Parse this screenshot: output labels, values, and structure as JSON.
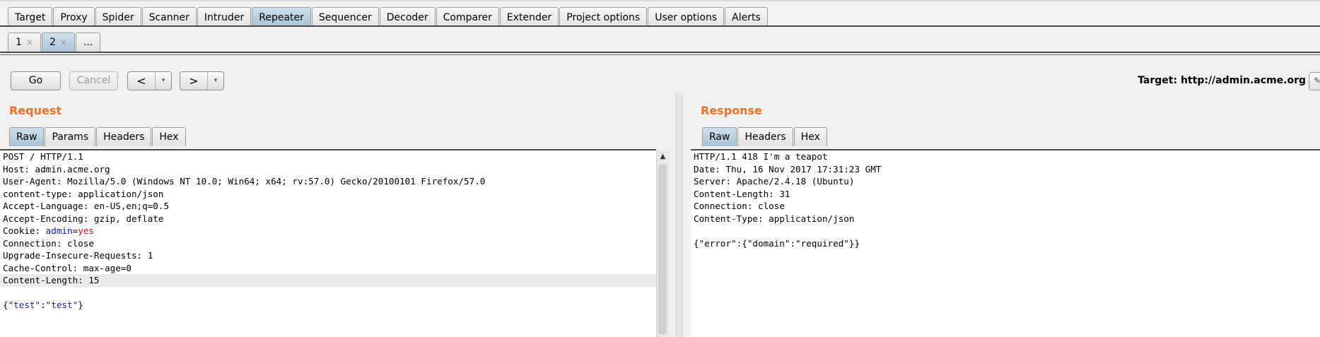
{
  "main_tabs": [
    "Target",
    "Proxy",
    "Spider",
    "Scanner",
    "Intruder",
    "Repeater",
    "Sequencer",
    "Decoder",
    "Comparer",
    "Extender",
    "Project options",
    "User options",
    "Alerts"
  ],
  "active_main_tab": "Repeater",
  "sub_tabs": [
    {
      "label": "1",
      "close": "×"
    },
    {
      "label": "2",
      "close": "×"
    },
    {
      "label": "..."
    }
  ],
  "toolbar": {
    "go_label": "Go",
    "cancel_label": "Cancel",
    "back_label": "<",
    "forward_label": ">",
    "dropdown_glyph": "▾",
    "target_text": "Target: http://admin.acme.org",
    "edit_icon": "pencil-icon"
  },
  "request": {
    "title": "Request",
    "tabs": [
      "Raw",
      "Params",
      "Headers",
      "Hex"
    ],
    "active_tab": "Raw",
    "lines": [
      "POST / HTTP/1.1",
      "Host: admin.acme.org",
      "User-Agent: Mozilla/5.0 (Windows NT 10.0; Win64; x64; rv:57.0) Gecko/20100101 Firefox/57.0",
      "content-type: application/json",
      "Accept-Language: en-US,en;q=0.5",
      "Accept-Encoding: gzip, deflate",
      "Cookie: admin=yes",
      "Connection: close",
      "Upgrade-Insecure-Requests: 1",
      "Cache-Control: max-age=0",
      "Content-Length: 15",
      "",
      "{\"test\":\"test\"}"
    ],
    "cookie_prefix": "Cookie: ",
    "cookie_name": "admin",
    "cookie_eq": "=",
    "cookie_value": "yes",
    "body_open": "{",
    "body_key": "\"test\"",
    "body_colon": ":",
    "body_value": "\"test\"",
    "body_close": "}"
  },
  "response": {
    "title": "Response",
    "tabs": [
      "Raw",
      "Headers",
      "Hex"
    ],
    "active_tab": "Raw",
    "lines": [
      "HTTP/1.1 418 I'm a teapot",
      "Date: Thu, 16 Nov 2017 17:31:23 GMT",
      "Server: Apache/2.4.18 (Ubuntu)",
      "Content-Length: 31",
      "Connection: close",
      "Content-Type: application/json",
      "",
      "{\"error\":{\"domain\":\"required\"}}"
    ]
  },
  "colors": {
    "section_title": "#e8712b",
    "active_tab": "#a8c3d6",
    "json_key": "#1a1aa6",
    "json_value": "#c0141a"
  }
}
